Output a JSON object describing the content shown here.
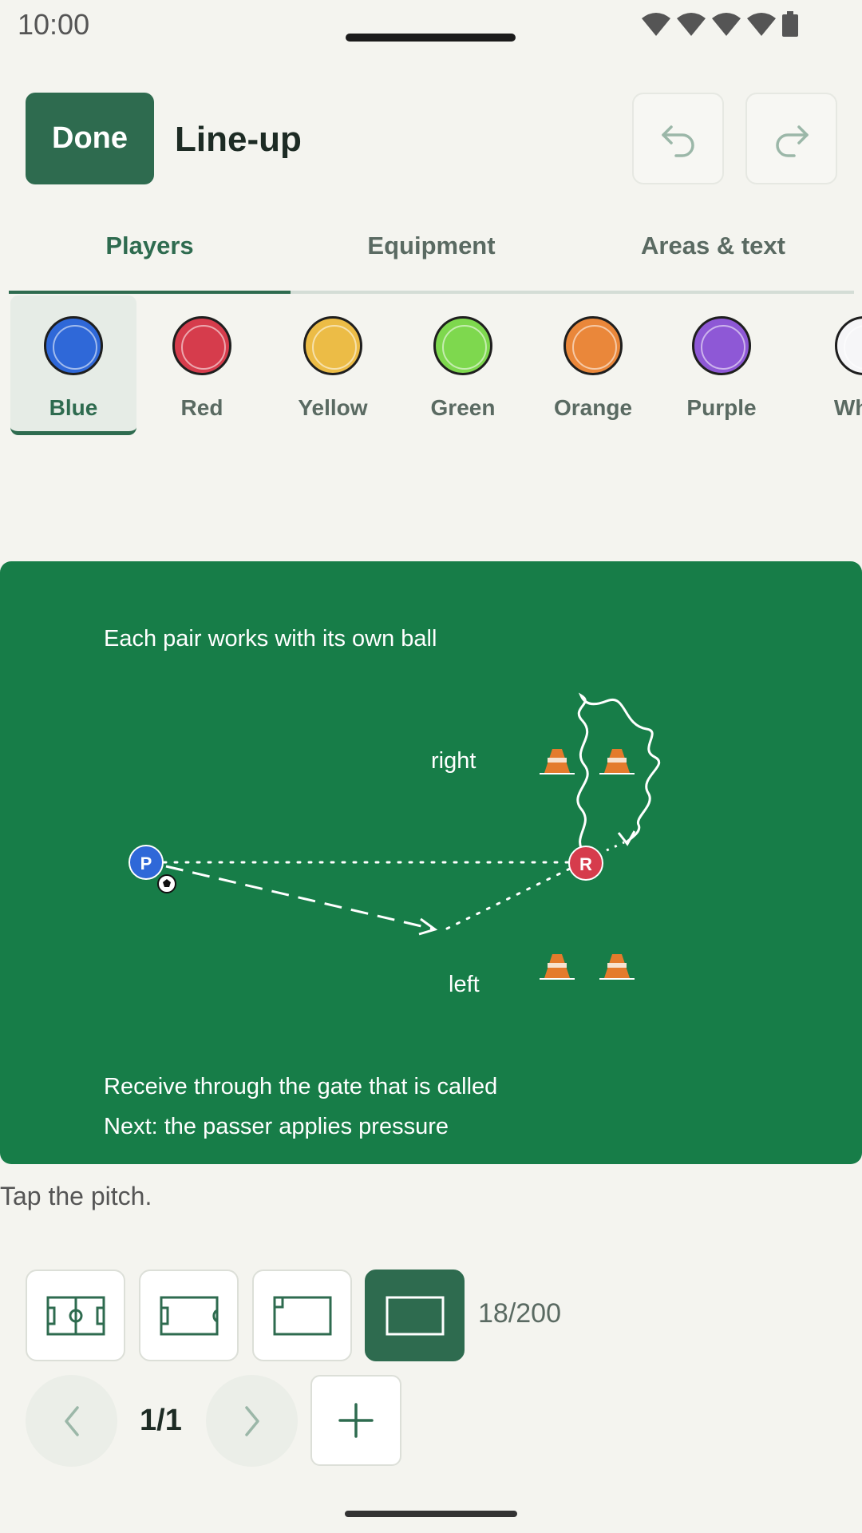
{
  "status_bar": {
    "time": "10:00"
  },
  "header": {
    "done_label": "Done",
    "title": "Line-up"
  },
  "tabs": [
    {
      "label": "Players",
      "active": true
    },
    {
      "label": "Equipment",
      "active": false
    },
    {
      "label": "Areas & text",
      "active": false
    }
  ],
  "swatches": [
    {
      "label": "Blue",
      "color": "#2f68d8",
      "selected": true
    },
    {
      "label": "Red",
      "color": "#d63c4c",
      "selected": false
    },
    {
      "label": "Yellow",
      "color": "#ecbc46",
      "selected": false
    },
    {
      "label": "Green",
      "color": "#7ed84e",
      "selected": false
    },
    {
      "label": "Orange",
      "color": "#ea873a",
      "selected": false
    },
    {
      "label": "Purple",
      "color": "#8e58d6",
      "selected": false
    },
    {
      "label": "White",
      "color": "#f6f6f8",
      "selected": false
    }
  ],
  "pitch": {
    "color": "#177d48",
    "text_top": "Each pair works with its own ball",
    "label_right": "right",
    "label_left": "left",
    "text_bottom_1": "Receive through the gate that is called",
    "text_bottom_2": "Next: the passer applies pressure",
    "player_blue_marker": "P",
    "player_red_marker": "R"
  },
  "hint": "Tap the pitch.",
  "toolbar": {
    "counter": "18/200",
    "active_layout": "full-frame"
  },
  "pagination": {
    "indicator": "1/1"
  },
  "colors": {
    "accent": "#2e6b4f",
    "pitch": "#177d48",
    "cone": "#e47b2c"
  }
}
